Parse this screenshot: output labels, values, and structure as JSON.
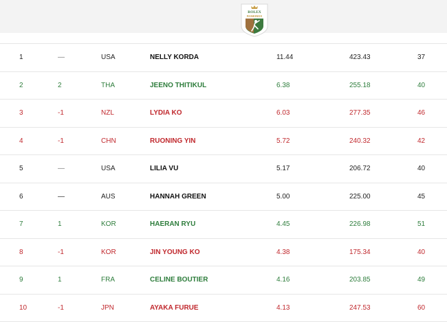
{
  "logo": {
    "line1": "ROLEX",
    "line2": "RANKINGS",
    "colors": {
      "gold": "#c9a04a",
      "green": "#3d7a3f",
      "brown": "#a0713e"
    }
  },
  "colors": {
    "up": "#2e7d3c",
    "down": "#c0282d",
    "neutral": "#222222"
  },
  "rows": [
    {
      "rank": "1",
      "move": "—",
      "country": "USA",
      "name": "NELLY KORDA",
      "avg": "11.44",
      "total": "423.43",
      "events": "37",
      "status": "same"
    },
    {
      "rank": "2",
      "move": "2",
      "country": "THA",
      "name": "JEENO THITIKUL",
      "avg": "6.38",
      "total": "255.18",
      "events": "40",
      "status": "up"
    },
    {
      "rank": "3",
      "move": "-1",
      "country": "NZL",
      "name": "LYDIA KO",
      "avg": "6.03",
      "total": "277.35",
      "events": "46",
      "status": "down"
    },
    {
      "rank": "4",
      "move": "-1",
      "country": "CHN",
      "name": "RUONING YIN",
      "avg": "5.72",
      "total": "240.32",
      "events": "42",
      "status": "down"
    },
    {
      "rank": "5",
      "move": "—",
      "country": "USA",
      "name": "LILIA VU",
      "avg": "5.17",
      "total": "206.72",
      "events": "40",
      "status": "same"
    },
    {
      "rank": "6",
      "move": "—",
      "country": "AUS",
      "name": "HANNAH GREEN",
      "avg": "5.00",
      "total": "225.00",
      "events": "45",
      "status": "same"
    },
    {
      "rank": "7",
      "move": "1",
      "country": "KOR",
      "name": "HAERAN RYU",
      "avg": "4.45",
      "total": "226.98",
      "events": "51",
      "status": "up"
    },
    {
      "rank": "8",
      "move": "-1",
      "country": "KOR",
      "name": "JIN YOUNG KO",
      "avg": "4.38",
      "total": "175.34",
      "events": "40",
      "status": "down"
    },
    {
      "rank": "9",
      "move": "1",
      "country": "FRA",
      "name": "CELINE BOUTIER",
      "avg": "4.16",
      "total": "203.85",
      "events": "49",
      "status": "up"
    },
    {
      "rank": "10",
      "move": "-1",
      "country": "JPN",
      "name": "AYAKA FURUE",
      "avg": "4.13",
      "total": "247.53",
      "events": "60",
      "status": "down"
    }
  ]
}
